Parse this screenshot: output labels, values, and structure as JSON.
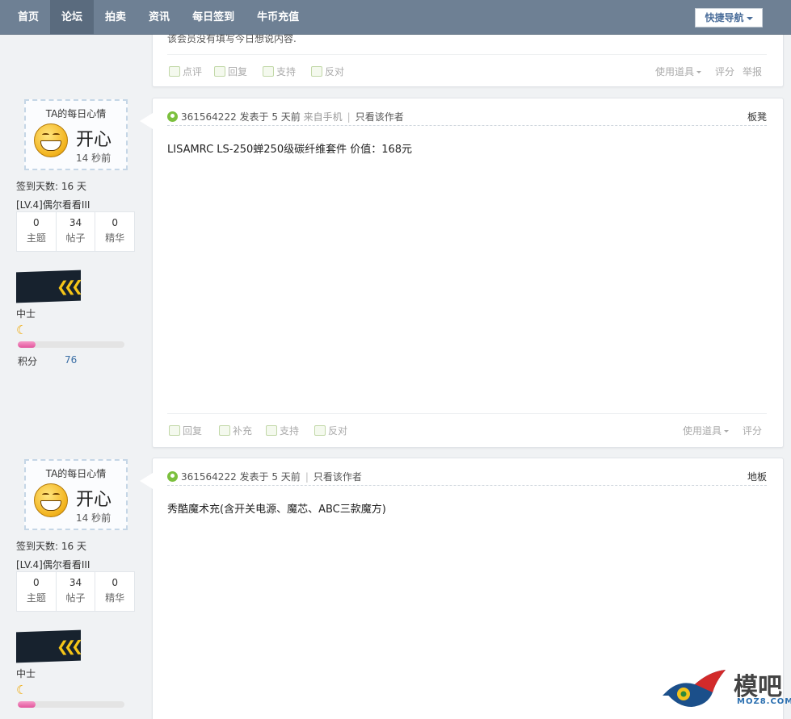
{
  "nav": {
    "items": [
      "首页",
      "论坛",
      "拍卖",
      "资讯",
      "每日签到",
      "牛币充值"
    ],
    "active_index": 1,
    "quick_nav": "快捷导航"
  },
  "top_card": {
    "text": "该会员没有填写今日想说内容.",
    "actions": [
      "点评",
      "回复",
      "支持",
      "反对"
    ],
    "right": [
      "使用道具",
      "评分",
      "举报"
    ]
  },
  "users": [
    {
      "mood_title": "TA的每日心情",
      "mood": "开心",
      "mood_time": "14 秒前",
      "sign_days": "签到天数: 16 天",
      "level": "[LV.4]偶尔看看III",
      "stats": [
        {
          "num": "0",
          "label": "主题"
        },
        {
          "num": "34",
          "label": "帖子"
        },
        {
          "num": "0",
          "label": "精华"
        }
      ],
      "rank": "中士",
      "progress": 0.17,
      "points_label": "积分",
      "points_value": "76"
    },
    {
      "mood_title": "TA的每日心情",
      "mood": "开心",
      "mood_time": "14 秒前",
      "sign_days": "签到天数: 16 天",
      "level": "[LV.4]偶尔看看III",
      "stats": [
        {
          "num": "0",
          "label": "主题"
        },
        {
          "num": "34",
          "label": "帖子"
        },
        {
          "num": "0",
          "label": "精华"
        }
      ],
      "rank": "中士",
      "progress": 0.17
    }
  ],
  "posts": [
    {
      "author": "361564222",
      "posted": "发表于 5 天前",
      "source": "来自手机",
      "only_author": "只看该作者",
      "floor": "板凳",
      "content": "LISAMRC  LS-250蝉250级碳纤维套件  价值：168元",
      "actions": [
        "回复",
        "补充",
        "支持",
        "反对"
      ],
      "right": [
        "使用道具",
        "评分"
      ]
    },
    {
      "author": "361564222",
      "posted": "发表于 5 天前",
      "only_author": "只看该作者",
      "floor": "地板",
      "content": "秀酷魔术充(含开关电源、魔芯、ABC三款魔方)"
    }
  ],
  "logo": {
    "text": "模吧",
    "sub": "MOZ8.COM"
  }
}
